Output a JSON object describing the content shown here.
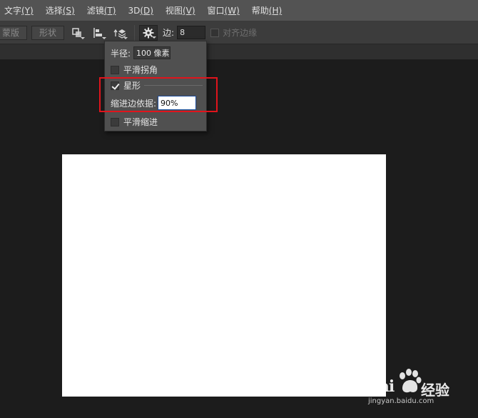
{
  "menubar": {
    "items": [
      {
        "label": "文字",
        "key": "(Y)"
      },
      {
        "label": "选择",
        "key": "(S)"
      },
      {
        "label": "滤镜",
        "key": "(T)"
      },
      {
        "label": "3D",
        "key": "(D)"
      },
      {
        "label": "视图",
        "key": "(V)"
      },
      {
        "label": "窗口",
        "key": "(W)"
      },
      {
        "label": "帮助",
        "key": "(H)"
      }
    ]
  },
  "options": {
    "mask_label": "蒙版",
    "shape_label": "形状",
    "edge_label": "边:",
    "edge_value": "8",
    "align_label": "对齐边缘"
  },
  "dropdown": {
    "radius_label": "半径:",
    "radius_value": "100 像素",
    "smooth_corners_label": "平滑拐角",
    "star_label": "星形",
    "indent_label": "缩进边依据:",
    "indent_value": "90%",
    "smooth_indent_label": "平滑缩进"
  },
  "watermark": {
    "brand": "Bai",
    "brand2": "百",
    "jingyan": "经验",
    "url": "jingyan.baidu.com"
  },
  "colors": {
    "highlight": "#e0141c",
    "canvas": "#ffffff",
    "workspace": "#1c1c1c"
  }
}
